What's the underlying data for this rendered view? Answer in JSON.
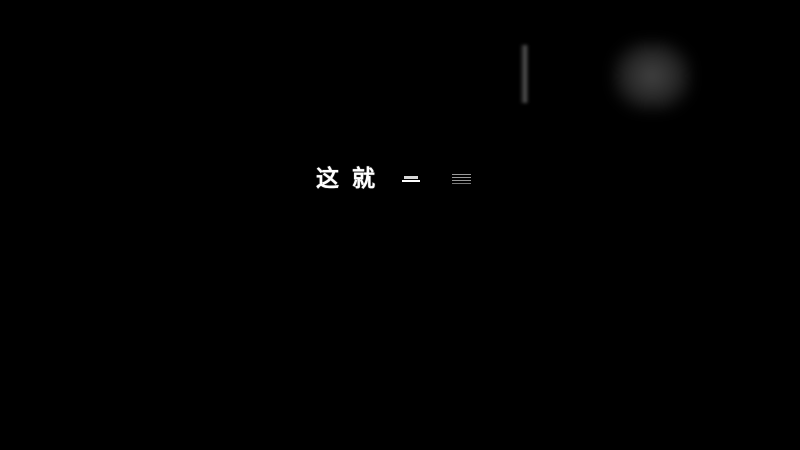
{
  "scene": {
    "background_color": "#000000",
    "caption": {
      "chars": [
        "这",
        "就"
      ],
      "text_color": "#ffffff"
    },
    "partial_glyph_count": 2
  }
}
